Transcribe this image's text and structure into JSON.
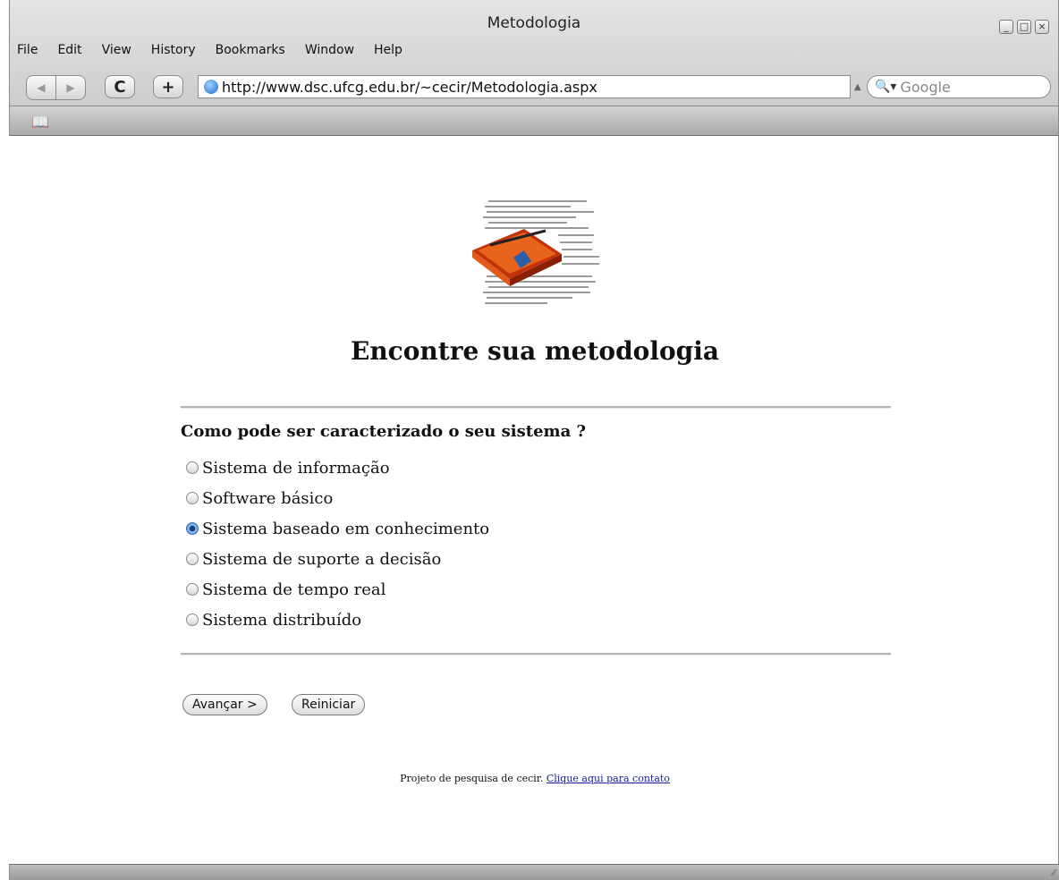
{
  "window": {
    "title": "Metodologia",
    "min_label": "_",
    "max_label": "□",
    "close_label": "×"
  },
  "menu": {
    "items": [
      "File",
      "Edit",
      "View",
      "History",
      "Bookmarks",
      "Window",
      "Help"
    ]
  },
  "toolbar": {
    "back_label": "◀",
    "forward_label": "▶",
    "reload_label": "C",
    "add_label": "+",
    "url": "http://www.dsc.ufcg.edu.br/~cecir/Metodologia.aspx",
    "search_placeholder": "Google"
  },
  "page": {
    "heading": "Encontre sua metodologia",
    "question": "Como pode ser caracterizado o seu sistema ?",
    "options": [
      {
        "label": "Sistema de informação",
        "selected": false
      },
      {
        "label": "Software básico",
        "selected": false
      },
      {
        "label": "Sistema baseado em conhecimento",
        "selected": true
      },
      {
        "label": "Sistema de suporte a decisão",
        "selected": false
      },
      {
        "label": "Sistema de tempo real",
        "selected": false
      },
      {
        "label": "Sistema distribuído",
        "selected": false
      }
    ],
    "next_button": "Avançar >",
    "reset_button": "Reiniciar",
    "footer_text": "Projeto de pesquisa de cecir. ",
    "footer_link": "Clique aqui para contato"
  }
}
